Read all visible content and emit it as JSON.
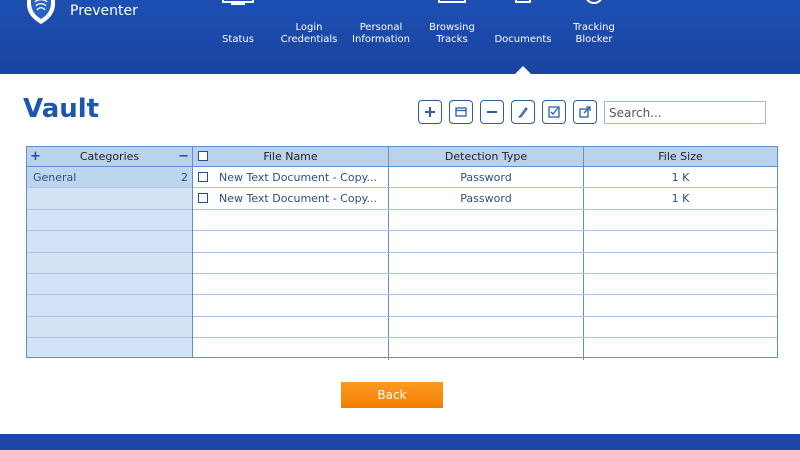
{
  "app": {
    "name_line2": "Preventer"
  },
  "nav": [
    {
      "id": "status",
      "label_1": "Status",
      "label_2": ""
    },
    {
      "id": "login",
      "label_1": "Login",
      "label_2": "Credentials"
    },
    {
      "id": "personal",
      "label_1": "Personal",
      "label_2": "Information"
    },
    {
      "id": "browsing",
      "label_1": "Browsing",
      "label_2": "Tracks"
    },
    {
      "id": "documents",
      "label_1": "Documents",
      "label_2": ""
    },
    {
      "id": "tracking",
      "label_1": "Tracking",
      "label_2": "Blocker"
    }
  ],
  "page": {
    "title": "Vault"
  },
  "search": {
    "placeholder": "Search..."
  },
  "categories": {
    "header": "Categories",
    "add_symbol": "+",
    "remove_symbol": "−",
    "items": [
      {
        "name": "General",
        "count": "2"
      }
    ]
  },
  "table": {
    "columns": [
      "File Name",
      "Detection Type",
      "File Size"
    ],
    "rows": [
      {
        "file_name": "New Text Document - Copy...",
        "detection_type": "Password",
        "file_size": "1 K"
      },
      {
        "file_name": "New Text Document - Copy...",
        "detection_type": "Password",
        "file_size": "1 K"
      }
    ]
  },
  "actions": {
    "back_label": "Back"
  },
  "colors": {
    "header_blue": "#1d4fb3",
    "accent_orange": "#f58a0b",
    "title_blue": "#1b56b0"
  }
}
